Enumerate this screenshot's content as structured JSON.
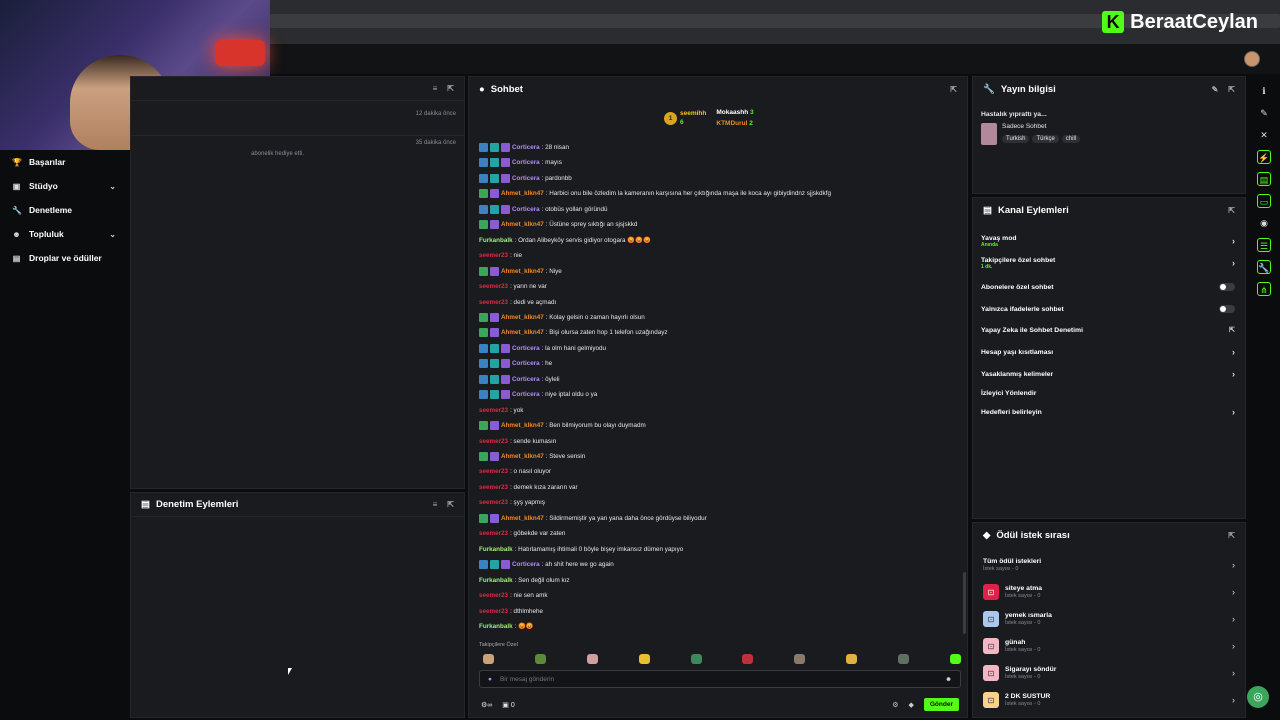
{
  "brand": {
    "name": "BeraatCeylan",
    "logo_letter": "K"
  },
  "nav": [
    {
      "label": "Başarılar",
      "icon": "trophy-icon",
      "expand": false
    },
    {
      "label": "Stüdyo",
      "icon": "studio-icon",
      "expand": true
    },
    {
      "label": "Denetleme",
      "icon": "wrench-icon",
      "expand": false
    },
    {
      "label": "Topluluk",
      "icon": "community-icon",
      "expand": true
    },
    {
      "label": "Droplar ve ödüller",
      "icon": "drops-icon",
      "expand": false
    }
  ],
  "activity": {
    "items": [
      {
        "time": "12 dakika önce",
        "text": ""
      },
      {
        "time": "35 dakika önce",
        "text": "abonelik hediye etti."
      }
    ]
  },
  "mod_panel": {
    "title": "Denetim Eylemleri"
  },
  "chat": {
    "title": "Sohbet",
    "leaderboard": [
      {
        "rank": "1",
        "name": "seemihh",
        "value": "6"
      },
      {
        "rank": "",
        "name": "Mokaashh",
        "value": "3"
      },
      {
        "rank": "",
        "name": "KTMDurul",
        "value": "2"
      }
    ],
    "messages": [
      {
        "user": "Corticera",
        "color": "blue",
        "text": ": 28 nisan",
        "badges": 3
      },
      {
        "user": "Corticera",
        "color": "blue",
        "text": ": mayıs",
        "badges": 3
      },
      {
        "user": "Corticera",
        "color": "blue",
        "text": ": pardonbb",
        "badges": 3
      },
      {
        "user": "Ahmet_klkn47",
        "color": "orange",
        "text": ": Harbici onu bile özledim la kameranın karşısına her çıktığında maşa ile koca ayı gibiydindnz sjjskdkfg",
        "badges": 2
      },
      {
        "user": "Corticera",
        "color": "blue",
        "text": ": otobüs yolları göründü",
        "badges": 3
      },
      {
        "user": "Ahmet_klkn47",
        "color": "orange",
        "text": ": Üstüne sprey sıktığı an sjsjskkd",
        "badges": 2
      },
      {
        "user": "Furkanbalk",
        "color": "green",
        "text": ": Ordan Alibeyköy servis gidiyor otogara 😡😡😡",
        "badges": 0
      },
      {
        "user": "seemer23",
        "color": "red",
        "text": ": nie",
        "badges": 0
      },
      {
        "user": "Ahmet_klkn47",
        "color": "orange",
        "text": ": Niye",
        "badges": 2
      },
      {
        "user": "seemer23",
        "color": "red",
        "text": ": yarın ne var",
        "badges": 0
      },
      {
        "user": "seemer23",
        "color": "red",
        "text": ": dedi ve açmadı",
        "badges": 0
      },
      {
        "user": "Ahmet_klkn47",
        "color": "orange",
        "text": ": Kolay gelsin o zaman hayırlı olsun",
        "badges": 2
      },
      {
        "user": "Ahmet_klkn47",
        "color": "orange",
        "text": ": Bişi olursa zaten hop 1 telefon uzağındayz",
        "badges": 2
      },
      {
        "user": "Corticera",
        "color": "blue",
        "text": ": la olm hani gelmiyodu",
        "badges": 3
      },
      {
        "user": "Corticera",
        "color": "blue",
        "text": ": he",
        "badges": 3
      },
      {
        "user": "Corticera",
        "color": "blue",
        "text": ": öyleli",
        "badges": 3
      },
      {
        "user": "Corticera",
        "color": "blue",
        "text": ": niye iptal oldu o ya",
        "badges": 3
      },
      {
        "user": "seemer23",
        "color": "red",
        "text": ": yok",
        "badges": 0
      },
      {
        "user": "Ahmet_klkn47",
        "color": "orange",
        "text": ": Ben bilmiyorum bu olayı duymadm",
        "badges": 2
      },
      {
        "user": "seemer23",
        "color": "red",
        "text": ": sende kumasın",
        "badges": 0
      },
      {
        "user": "Ahmet_klkn47",
        "color": "orange",
        "text": ": Steve sensin",
        "badges": 2
      },
      {
        "user": "seemer23",
        "color": "red",
        "text": ": o nasıl oluyor",
        "badges": 0
      },
      {
        "user": "seemer23",
        "color": "red",
        "text": ": demek kıza zararın var",
        "badges": 0
      },
      {
        "user": "seemer23",
        "color": "red",
        "text": ": şyş yapmış",
        "badges": 0
      },
      {
        "user": "Ahmet_klkn47",
        "color": "orange",
        "text": ": Sildirmemiştir ya yan yana daha önce gördüyse biliyodur",
        "badges": 2
      },
      {
        "user": "seemer23",
        "color": "red",
        "text": ": göbekde var zaten",
        "badges": 0
      },
      {
        "user": "Furkanbalk",
        "color": "green",
        "text": ": Hatırlamamış ihtimali 0 böyle bişey imkansız dümen yapıyo",
        "badges": 0
      },
      {
        "user": "Corticera",
        "color": "blue",
        "text": ": ah shit here we go again",
        "badges": 3
      },
      {
        "user": "Furkanbalk",
        "color": "green",
        "text": ": Sen değil olum kız",
        "badges": 0
      },
      {
        "user": "seemer23",
        "color": "red",
        "text": ": nie sen amk",
        "badges": 0
      },
      {
        "user": "seemer23",
        "color": "red",
        "text": ": dthlmhehe",
        "badges": 0
      },
      {
        "user": "Furkanbalk",
        "color": "green",
        "text": ": 😡😡",
        "badges": 0
      }
    ],
    "followers_only_label": "Takipçilere Özel",
    "input_placeholder": "Bir mesaj gönderin",
    "footer_left": "∞",
    "footer_count": "0",
    "send_label": "Gönder"
  },
  "stream_info": {
    "title": "Yayın bilgisi",
    "stream_title": "Hastalık yıprattı ya...",
    "category": "Sadece Sohbet",
    "tags": [
      "Turkish",
      "Türkçe",
      "chill"
    ]
  },
  "channel_actions": {
    "title": "Kanal Eylemleri",
    "rows": [
      {
        "label": "Yavaş mod",
        "sub": "Anında",
        "type": "chevron"
      },
      {
        "label": "Takipçilere özel sohbet",
        "sub": "1 dk.",
        "type": "chevron"
      },
      {
        "label": "Abonelere özel sohbet",
        "sub": "",
        "type": "toggle"
      },
      {
        "label": "Yalnızca ifadelerle sohbet",
        "sub": "",
        "type": "toggle"
      },
      {
        "label": "Yapay Zeka ile Sohbet Denetimi",
        "sub": "",
        "type": "external"
      },
      {
        "label": "Hesap yaşı kısıtlaması",
        "sub": "",
        "type": "chevron"
      },
      {
        "label": "Yasaklanmış kelimeler",
        "sub": "",
        "type": "chevron"
      },
      {
        "label": "İzleyici Yönlendir",
        "sub": "",
        "type": "none"
      },
      {
        "label": "Hedefleri belirleyin",
        "sub": "",
        "type": "chevron"
      }
    ]
  },
  "reward_queue": {
    "title": "Ödül istek sırası",
    "rows": [
      {
        "title": "Tüm ödül istekleri",
        "sub": "İstek sayısı - 0",
        "color": ""
      },
      {
        "title": "siteye atma",
        "sub": "İstek sayısı - 0",
        "color": "#e0224a"
      },
      {
        "title": "yemek ısmarla",
        "sub": "İstek sayısı - 0",
        "color": "#a9c7ef"
      },
      {
        "title": "günah",
        "sub": "İstek sayısı - 0",
        "color": "#f3b6c4"
      },
      {
        "title": "Sigarayı söndür",
        "sub": "İstek sayısı - 0",
        "color": "#f3b6c4"
      },
      {
        "title": "2 DK SUSTUR",
        "sub": "İstek sayısı - 0",
        "color": "#f6d28c"
      }
    ]
  }
}
